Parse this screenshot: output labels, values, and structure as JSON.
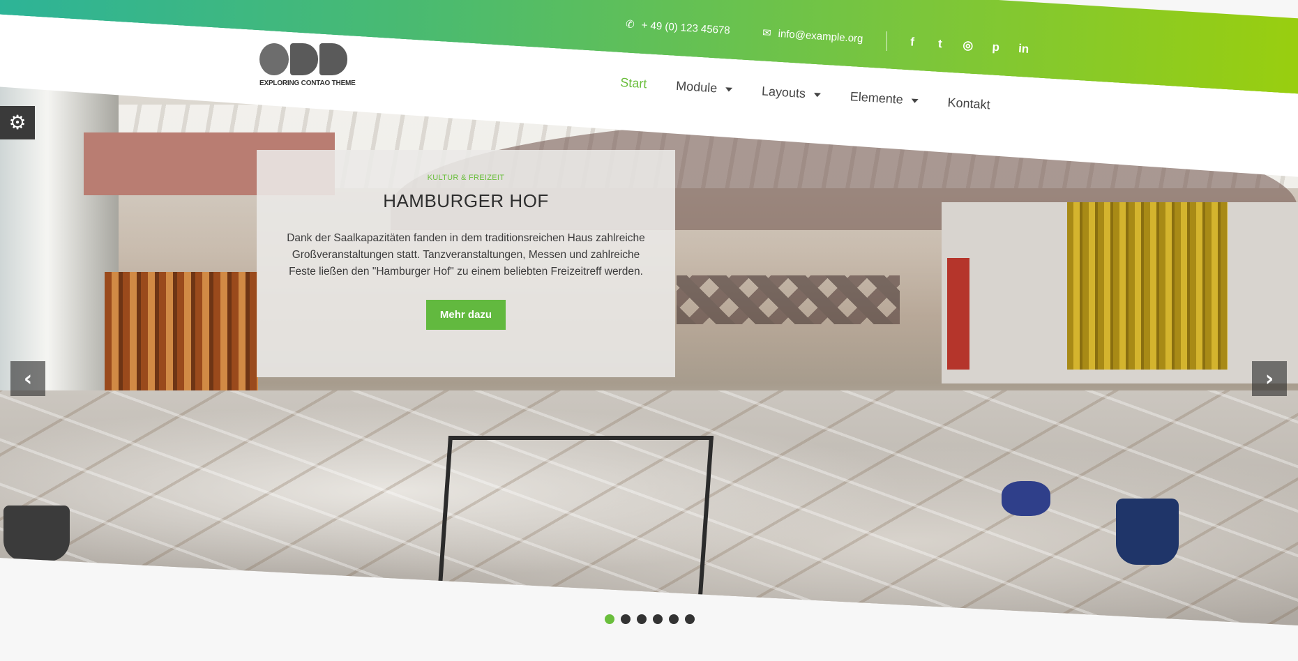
{
  "colors": {
    "accent": "#6abe3c",
    "gradient_start": "#2bb39a",
    "gradient_end": "#9ccf0b"
  },
  "header": {
    "logo_text": "EXPLORING CONTAO THEME",
    "phone": "+ 49 (0) 123 45678",
    "email": "info@example.org",
    "social_icons": [
      "facebook-icon",
      "twitter-icon",
      "instagram-icon",
      "pinterest-icon",
      "linkedin-icon"
    ]
  },
  "nav": {
    "items": [
      {
        "label": "Start",
        "active": true,
        "dropdown": false
      },
      {
        "label": "Module",
        "active": false,
        "dropdown": true
      },
      {
        "label": "Layouts",
        "active": false,
        "dropdown": true
      },
      {
        "label": "Elemente",
        "active": false,
        "dropdown": true
      },
      {
        "label": "Kontakt",
        "active": false,
        "dropdown": false
      }
    ]
  },
  "slider": {
    "kicker": "KULTUR & FREIZEIT",
    "title": "HAMBURGER HOF",
    "text": "Dank der Saalkapazitäten fanden in dem traditionsreichen Haus zahlreiche Großveranstaltungen statt. Tanzveranstaltungen, Messen und zahlreiche Feste ließen den \"Hamburger Hof\" zu einem beliebten Freizeitreff werden.",
    "button_label": "Mehr dazu",
    "slide_count": 6,
    "active_slide": 1
  }
}
